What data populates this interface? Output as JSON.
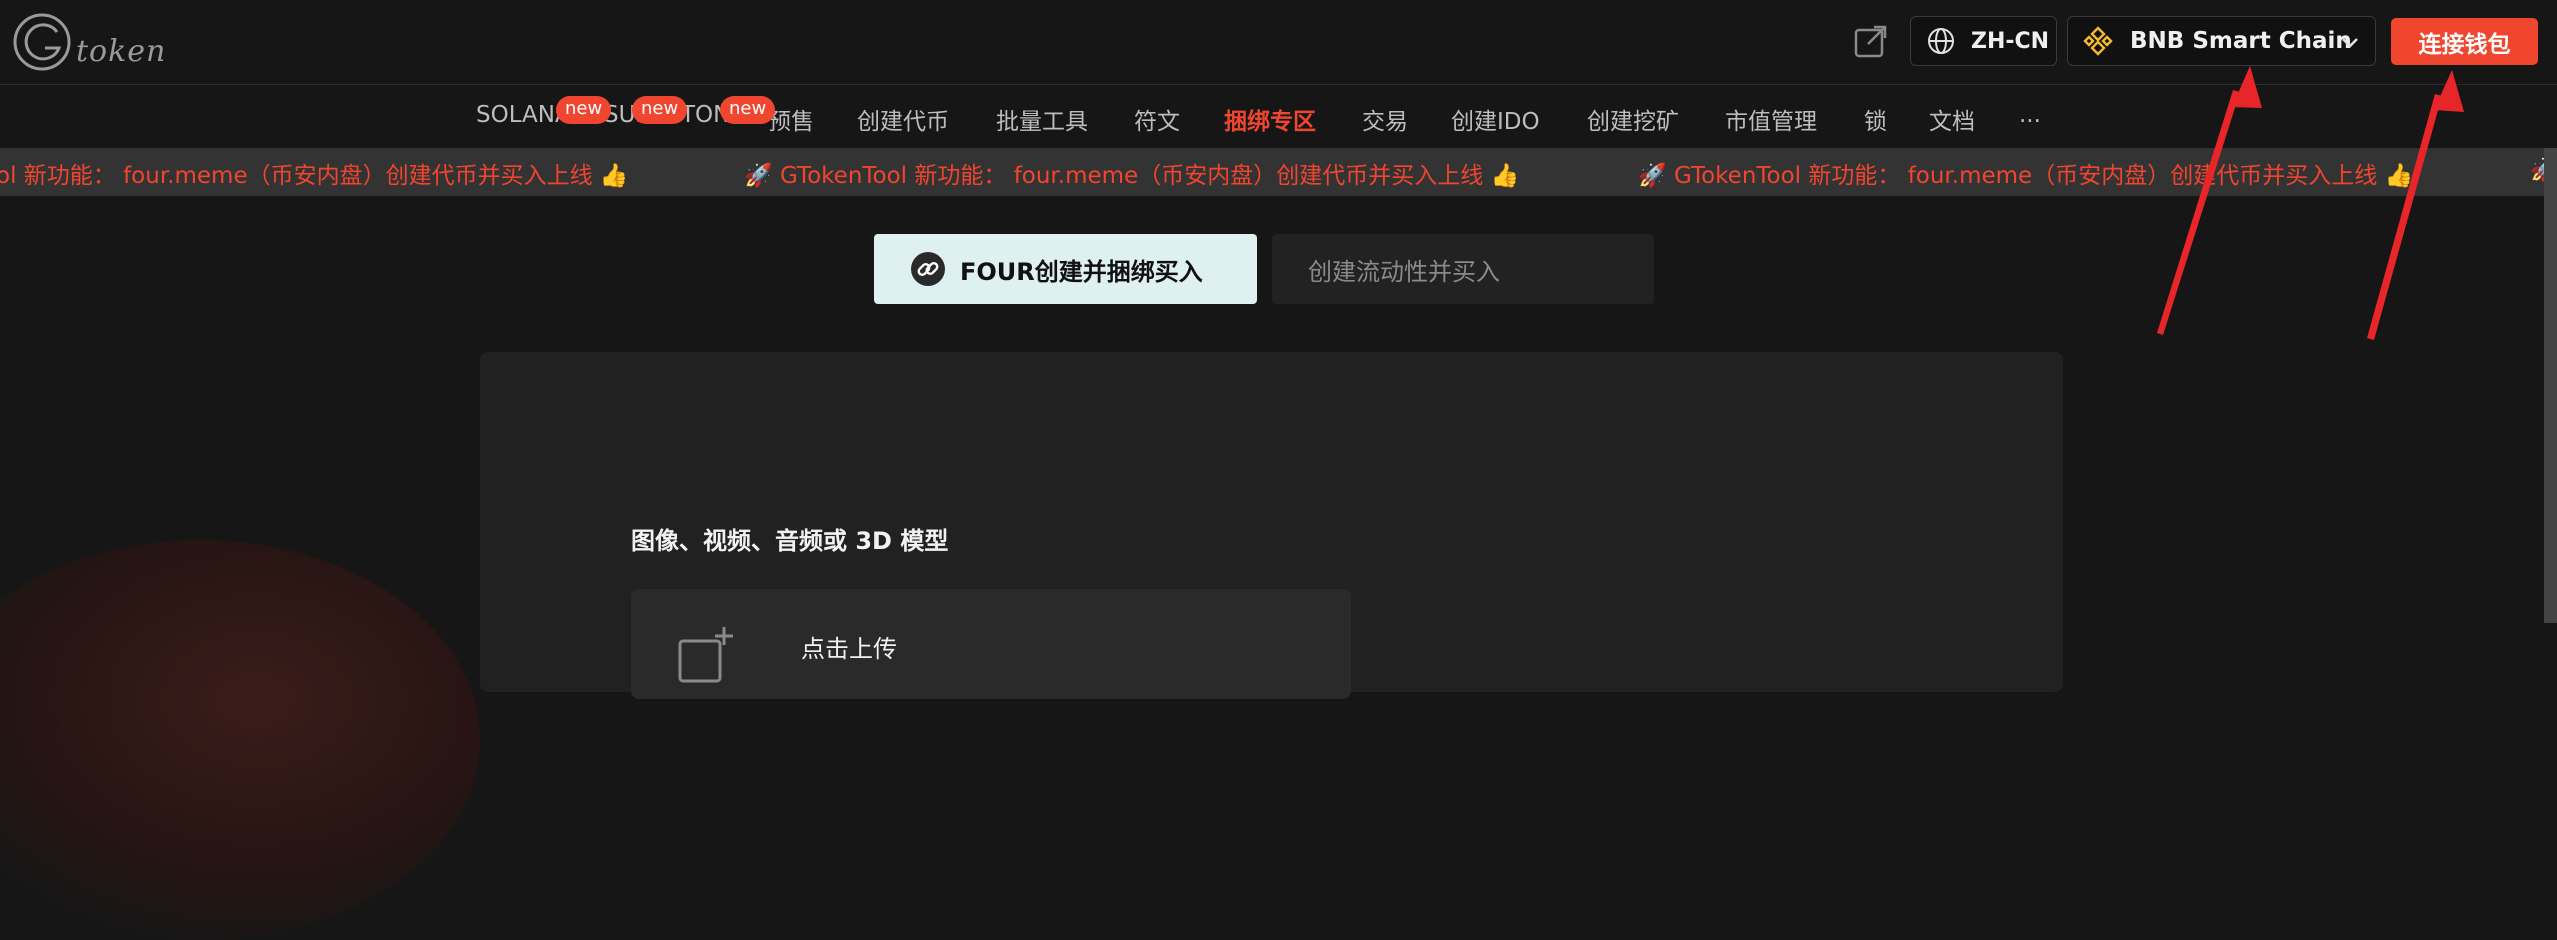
{
  "header": {
    "logo_text": "token",
    "lang_label": "ZH-CN",
    "chain_label": "BNB Smart Chain",
    "connect_label": "连接钱包"
  },
  "nav": {
    "items": [
      {
        "label": "SOLANA",
        "badge": "new"
      },
      {
        "label": "SUI",
        "badge": "new"
      },
      {
        "label": "TON",
        "badge": "new"
      },
      {
        "label": "预售"
      },
      {
        "label": "创建代币"
      },
      {
        "label": "批量工具"
      },
      {
        "label": "符文"
      },
      {
        "label": "捆绑专区",
        "active": true
      },
      {
        "label": "交易"
      },
      {
        "label": "创建IDO"
      },
      {
        "label": "创建挖矿"
      },
      {
        "label": "市值管理"
      },
      {
        "label": "锁"
      },
      {
        "label": "文档"
      },
      {
        "label": "..."
      }
    ]
  },
  "ticker": {
    "items": [
      "ol 新功能：  four.meme（币安内盘）创建代币并买入上线 👍",
      "🚀 GTokenTool 新功能：  four.meme（币安内盘）创建代币并买入上线 👍",
      "🚀 GTokenTool 新功能：  four.meme（币安内盘）创建代币并买入上线 👍",
      "🚀"
    ]
  },
  "tabs": [
    {
      "label": "FOUR创建并捆绑买入",
      "active": true
    },
    {
      "label": "创建流动性并买入",
      "active": false
    }
  ],
  "form": {
    "media_label": "图像、视频、音频或 3D 模型",
    "upload_text": "点击上传"
  },
  "colors": {
    "accent": "#f0452e",
    "tab_active_bg": "#dff0f0",
    "background": "#161616",
    "ticker_bg": "#333333"
  }
}
